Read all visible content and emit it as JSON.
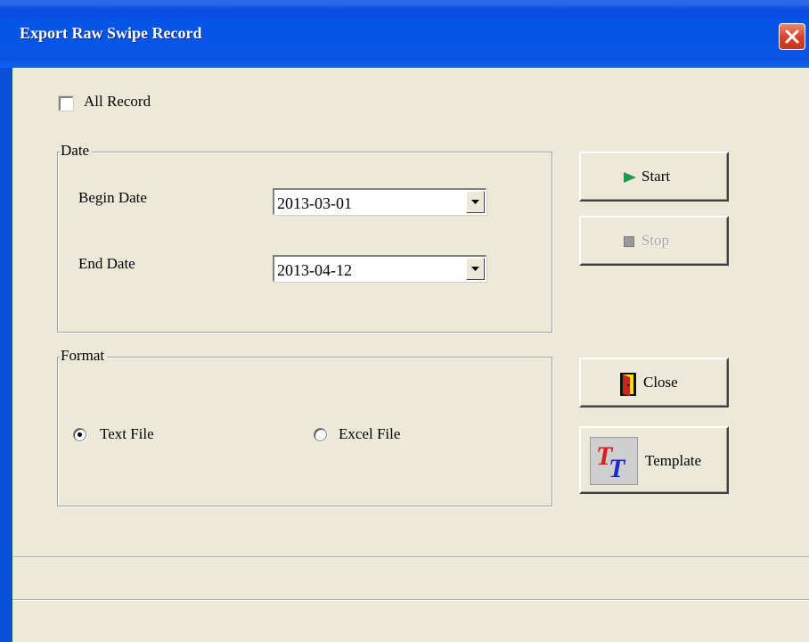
{
  "window": {
    "title": "Export Raw Swipe Record"
  },
  "options": {
    "all_record_label": "All Record",
    "all_record_checked": false
  },
  "date_group": {
    "label": "Date",
    "begin_label": "Begin Date",
    "begin_value": "2013-03-01",
    "end_label": "End Date",
    "end_value": "2013-04-12"
  },
  "format_group": {
    "label": "Format",
    "text_file_label": "Text File",
    "excel_file_label": "Excel File",
    "selected": "Text File"
  },
  "buttons": {
    "start_label": "Start",
    "stop_label": "Stop",
    "close_label": "Close",
    "template_label": "Template"
  },
  "icons": {
    "start": "play-icon",
    "stop": "stop-icon",
    "close": "door-icon",
    "template": "tt-font-icon",
    "title_close": "close-icon"
  },
  "colors": {
    "titlebar": "#0a55e6",
    "face": "#ece9d8",
    "play": "#1e9a4e",
    "close_btn": "#d5422a"
  }
}
